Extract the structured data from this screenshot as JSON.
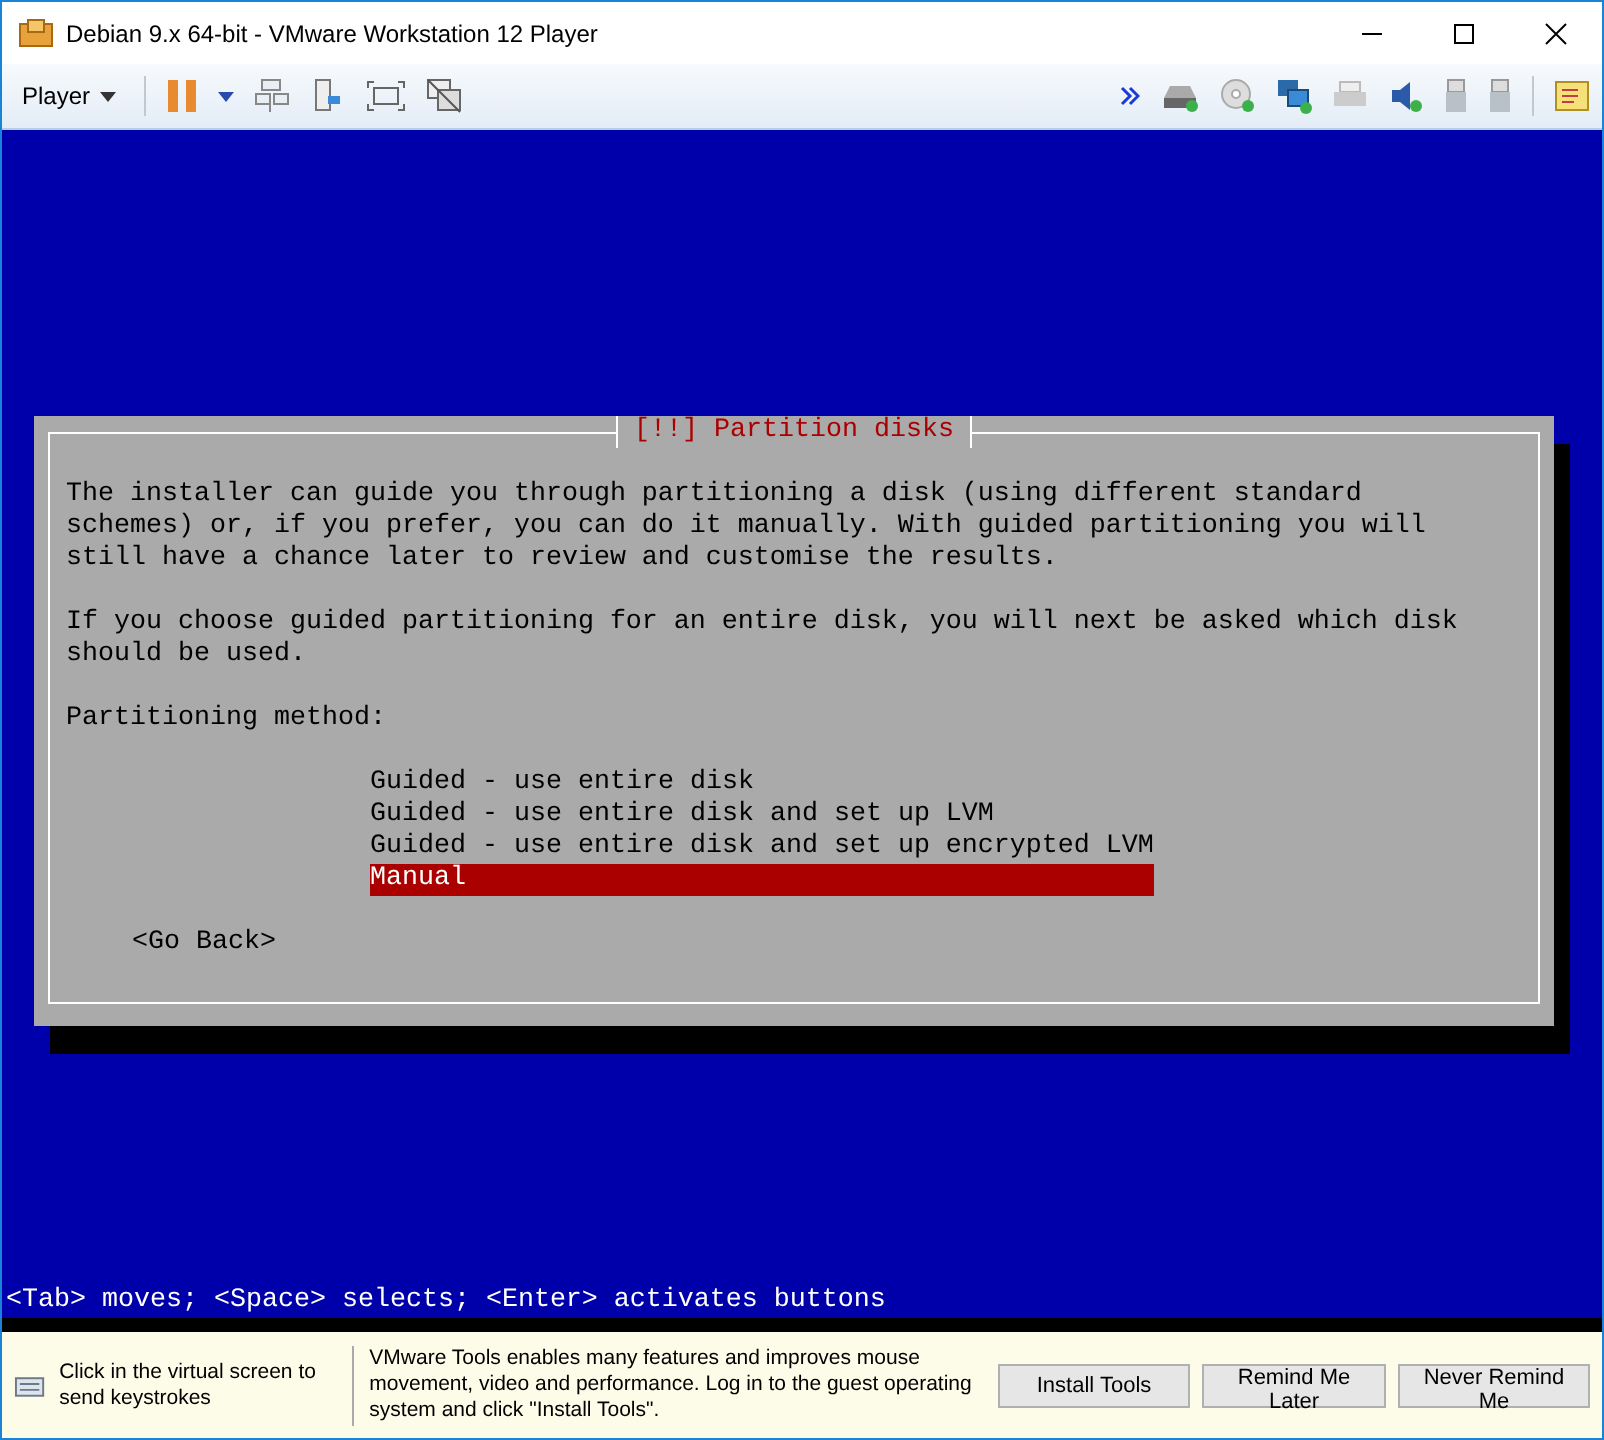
{
  "window": {
    "title": "Debian 9.x 64-bit - VMware Workstation 12 Player"
  },
  "toolbar": {
    "menu": "Player"
  },
  "installer": {
    "dialog_title": "[!!] Partition disks",
    "paragraphs": [
      "The installer can guide you through partitioning a disk (using different standard\nschemes) or, if you prefer, you can do it manually. With guided partitioning you will\nstill have a chance later to review and customise the results.",
      "If you choose guided partitioning for an entire disk, you will next be asked which disk\nshould be used."
    ],
    "prompt": "Partitioning method:",
    "options": [
      {
        "label": "Guided - use entire disk",
        "selected": false
      },
      {
        "label": "Guided - use entire disk and set up LVM",
        "selected": false
      },
      {
        "label": "Guided - use entire disk and set up encrypted LVM",
        "selected": false
      },
      {
        "label": "Manual",
        "selected": true
      }
    ],
    "back_button": "<Go Back>",
    "help_line": "<Tab> moves; <Space> selects; <Enter> activates buttons"
  },
  "notification": {
    "hint": "Click in the virtual screen to send keystrokes",
    "message": "VMware Tools enables many features and improves mouse movement, video and performance. Log in to the guest operating system and click \"Install Tools\".",
    "buttons": [
      "Install Tools",
      "Remind Me Later",
      "Never Remind Me"
    ]
  }
}
